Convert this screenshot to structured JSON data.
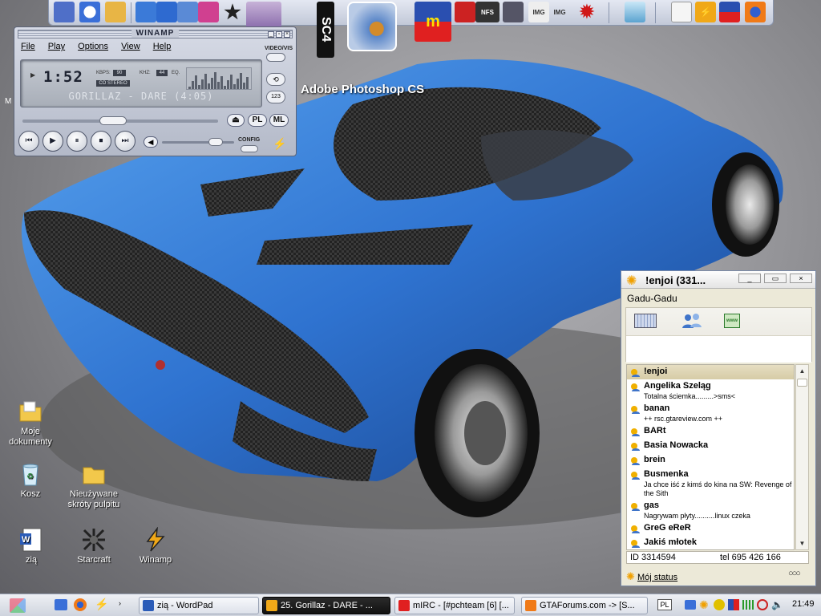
{
  "desktop": {
    "overlay_label": "Adobe Photoshop CS",
    "partial_label": "M",
    "icons": [
      {
        "label": "Moje\ndokumenty",
        "icon": "folder-icon"
      },
      {
        "label": "Kosz",
        "icon": "recycle-bin-icon"
      },
      {
        "label": "Nieużywane\nskróty pulpitu",
        "icon": "folder-icon"
      },
      {
        "label": "zią",
        "icon": "word-document-icon"
      },
      {
        "label": "Starcraft",
        "icon": "starcraft-icon"
      },
      {
        "label": "Winamp",
        "icon": "winamp-icon"
      }
    ]
  },
  "quicklaunch": {
    "sc4_label": "SC4",
    "items": [
      "network-icon",
      "clock-icon",
      "folder-icon",
      "paint-icon",
      "vs-icon",
      "poser-icon",
      "star-icon",
      "simcity-building-icon",
      "sc4-icon",
      "photoshop-icon",
      "mirc-icon",
      "floppy-icon",
      "nfs-icon",
      "img-tool-icon",
      "splat-icon",
      "recycle-bin-icon",
      "window-icon",
      "winamp-bolt-icon",
      "mirc-small-icon",
      "firefox-icon"
    ]
  },
  "winamp": {
    "title": "WINAMP",
    "menu": [
      "File",
      "Play",
      "Options",
      "View",
      "Help"
    ],
    "video_vis": "VIDEO/VIS",
    "time": "1:52",
    "kbps_label": "KBPS:",
    "kbps": "90",
    "khz_label": "KHZ:",
    "khz": "44",
    "eq_label": "EQ.",
    "stereo": "CO STEREO",
    "song": "GORILLAZ - DARE (4:05)",
    "song_elapsed_fraction": 0.457,
    "volume_fraction": 0.8,
    "pl": "PL",
    "ml": "ML",
    "config": "CONFIG",
    "side_repeat": "⟲",
    "side_123": "123",
    "eject": "⏏",
    "controls": {
      "prev": "⏮",
      "play": "▶",
      "pause": "⏸",
      "stop": "⏹",
      "next": "⏭"
    }
  },
  "gadugadu": {
    "title": "!enjoi (331...",
    "menu": "Gadu-Gadu",
    "contacts": [
      {
        "name": "!enjoi",
        "desc": "",
        "selected": true
      },
      {
        "name": "Angelika Szeląg",
        "desc": "Totalna ściemka.........>sms<"
      },
      {
        "name": "banan",
        "desc": "++ rsc.gtareview.com ++"
      },
      {
        "name": "BARt",
        "desc": ""
      },
      {
        "name": "Basia Nowacka",
        "desc": ""
      },
      {
        "name": "brein",
        "desc": ""
      },
      {
        "name": "Busmenka",
        "desc": "Ja chce iść z kimś do kina na SW: Revenge of the Sith"
      },
      {
        "name": "gas",
        "desc": "Nagrywam płyty..........linux czeka"
      },
      {
        "name": "GreG eReR",
        "desc": ""
      },
      {
        "name": "Jakiś młotek",
        "desc": ""
      }
    ],
    "id_text": "ID 3314594",
    "tel_text": "tel 695 426 166",
    "status": "Mój status"
  },
  "taskbar": {
    "tasks": [
      {
        "label": "zią - WordPad",
        "active": false
      },
      {
        "label": "25. Gorillaz - DARE - ...",
        "active": true
      },
      {
        "label": "mIRC - [#pchteam [6] [...",
        "active": false
      },
      {
        "label": "GTAForums.com -> [S...",
        "active": false
      }
    ],
    "lang": "PL",
    "clock": "21:49"
  },
  "colors": {
    "car_blue": "#2f73d0",
    "accent_dark": "#111111"
  }
}
